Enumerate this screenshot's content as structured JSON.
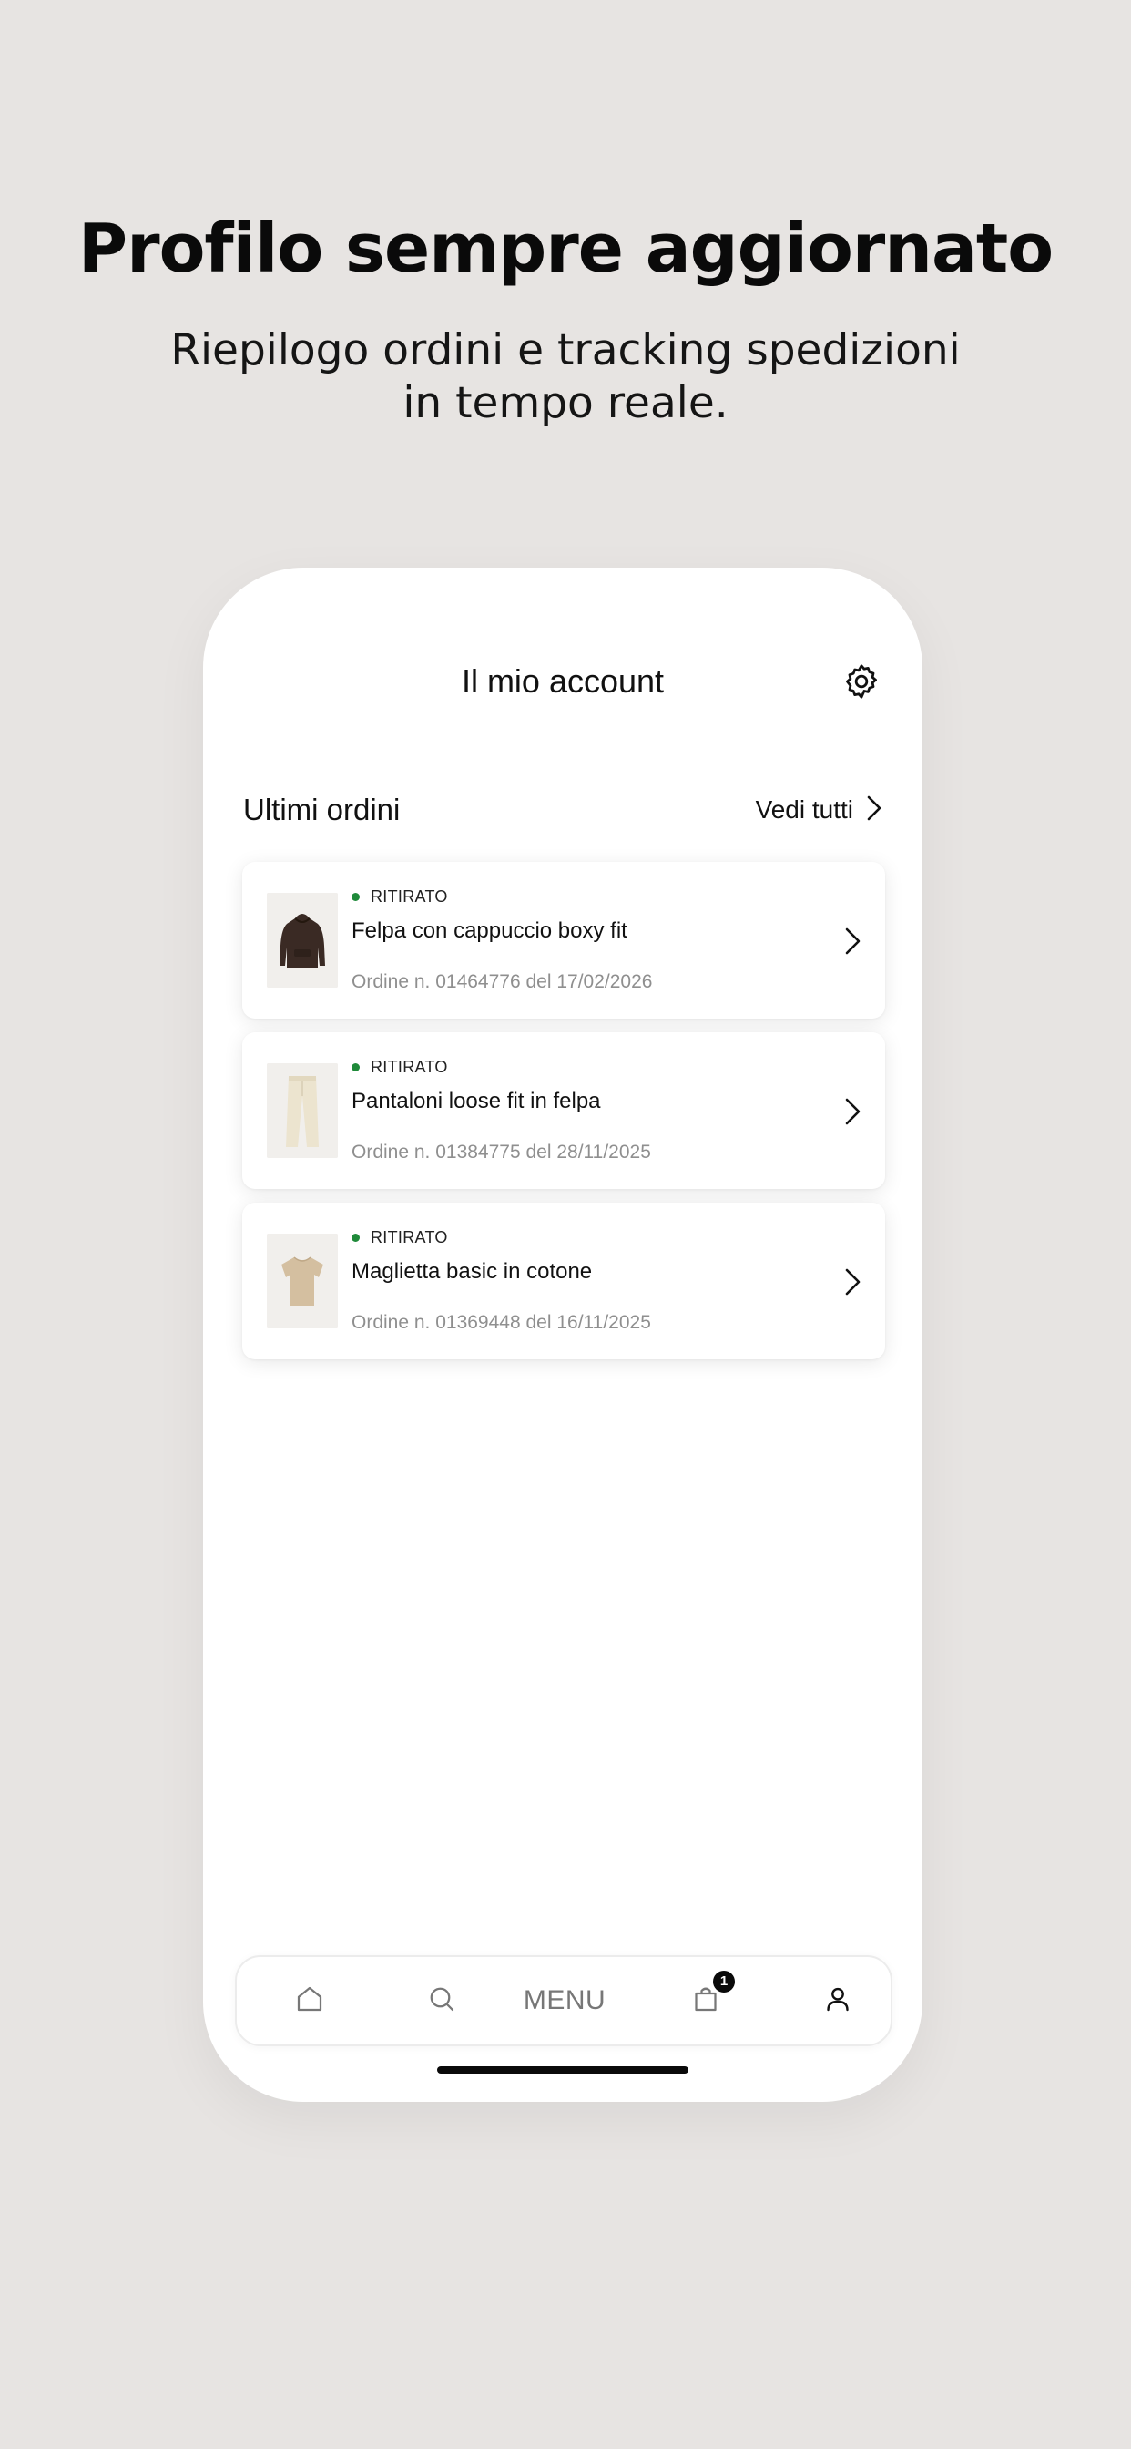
{
  "promo": {
    "headline": "Profilo sempre aggiornato",
    "subline_line1": "Riepilogo ordini e tracking spedizioni",
    "subline_line2": "in tempo reale."
  },
  "header": {
    "title": "Il mio account",
    "settings_icon": "gear-icon"
  },
  "orders_section": {
    "title": "Ultimi ordini",
    "see_all_label": "Vedi tutti",
    "see_all_icon": "chevron-right-icon"
  },
  "orders": [
    {
      "status": "RITIRATO",
      "status_color": "#1f8a3a",
      "name": "Felpa con cappuccio boxy fit",
      "meta": "Ordine n. 01464776 del 17/02/2026",
      "thumbnail_icon": "brown-hoodie-image"
    },
    {
      "status": "RITIRATO",
      "status_color": "#1f8a3a",
      "name": "Pantaloni loose fit in felpa",
      "meta": "Ordine n. 01384775 del 28/11/2025",
      "thumbnail_icon": "cream-pants-image"
    },
    {
      "status": "RITIRATO",
      "status_color": "#1f8a3a",
      "name": "Maglietta basic in cotone",
      "meta": "Ordine n. 01369448 del 16/11/2025",
      "thumbnail_icon": "beige-tshirt-image"
    }
  ],
  "tabbar": {
    "home_icon": "home-icon",
    "search_icon": "search-icon",
    "menu_label": "MENU",
    "cart_icon": "shopping-bag-icon",
    "cart_badge": "1",
    "profile_icon": "user-icon"
  },
  "colors": {
    "background": "#e7e4e2",
    "surface": "#ffffff",
    "status_green": "#1f8a3a",
    "text_primary": "#111111",
    "text_secondary": "#8f8f8f"
  }
}
